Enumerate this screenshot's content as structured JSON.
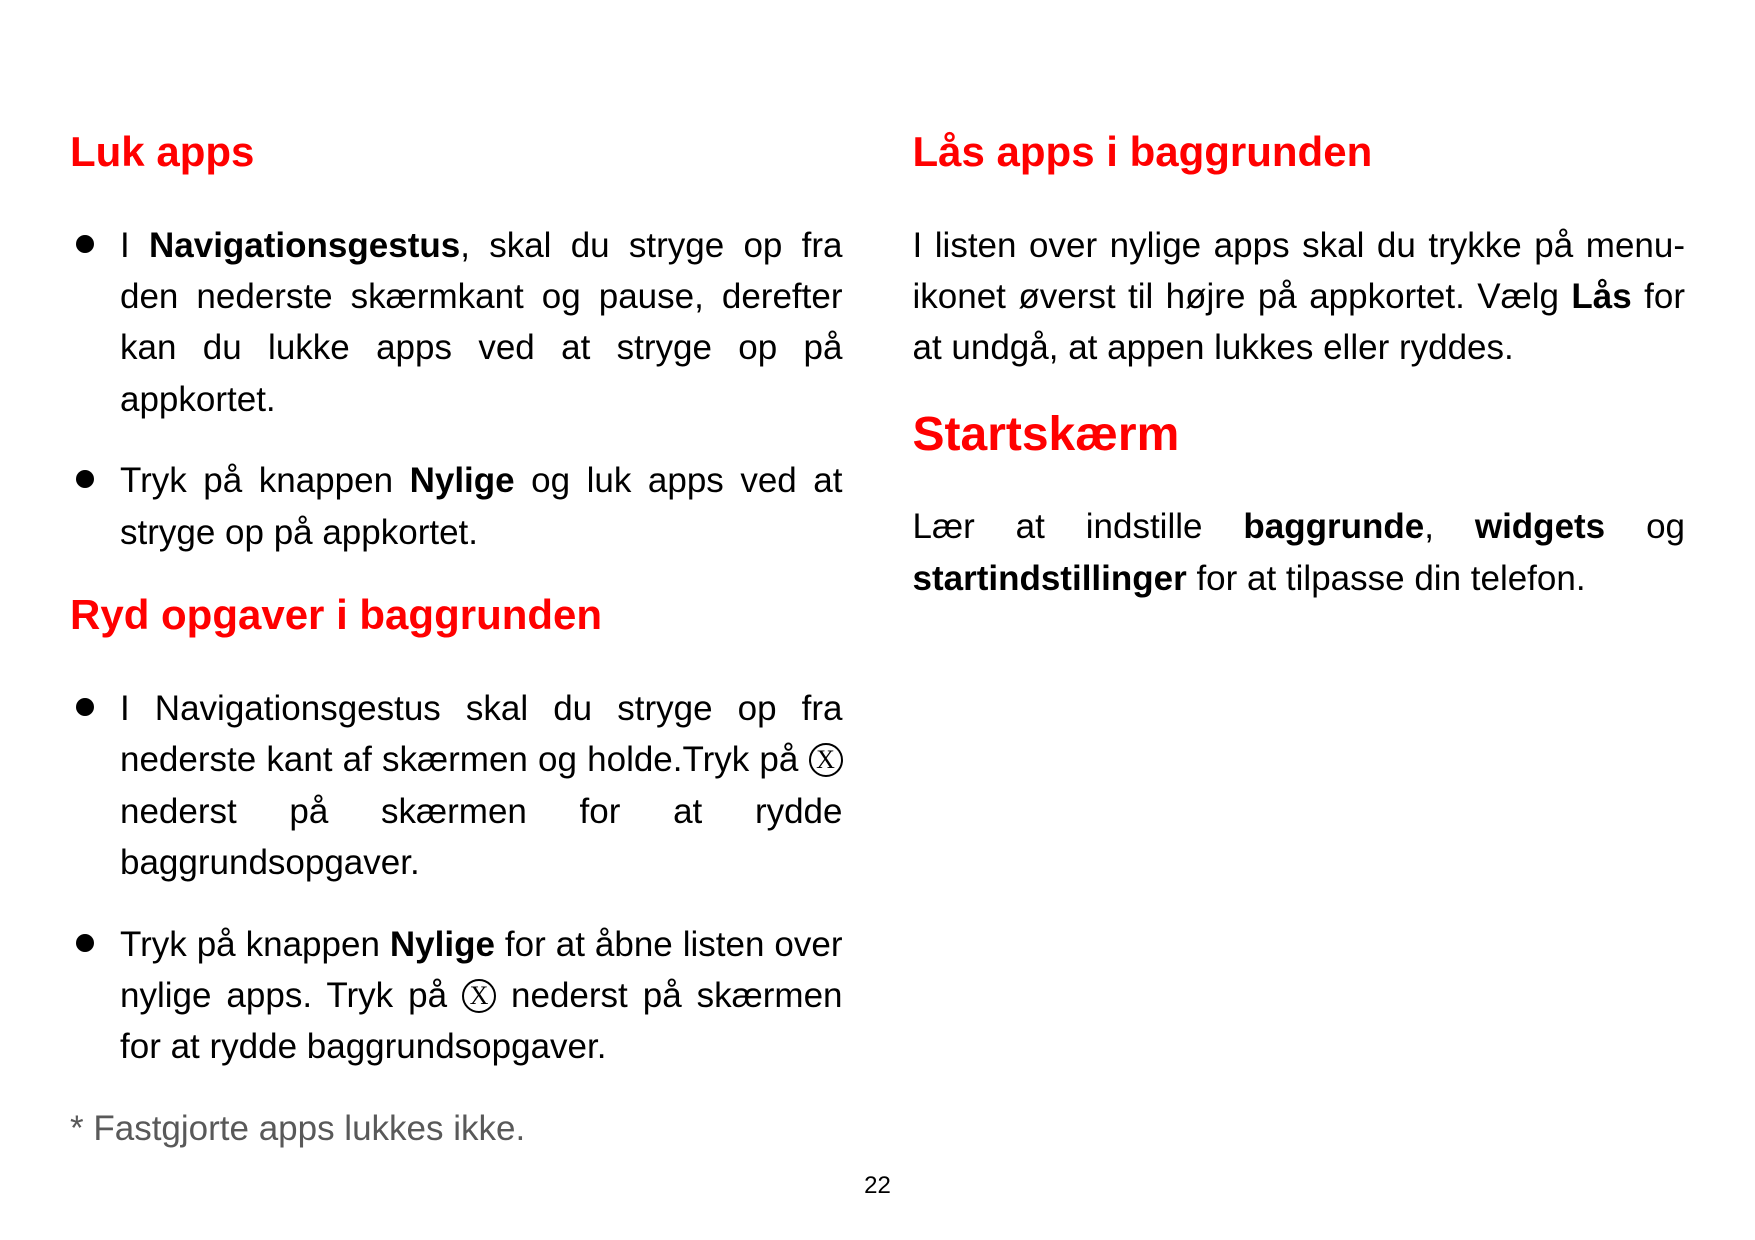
{
  "icons": {
    "circle_x_glyph": "X"
  },
  "page_number": "22",
  "left": {
    "h2a": "Luk apps",
    "li1_a": "I ",
    "li1_b_bold": "Navigationsgestus",
    "li1_c": ", skal du stryge op fra den nederste skærmkant og pause, derefter kan du lukke apps ved at stryge op på appkortet.",
    "li2_a": "Tryk på knappen ",
    "li2_b_bold": "Nylige",
    "li2_c": " og luk apps ved at stryge op på appkortet.",
    "h2b": "Ryd opgaver i baggrunden",
    "li3_a": "I Navigationsgestus skal du stryge op fra nederste kant af skærmen og holde.Tryk på ",
    "li3_b": " nederst på skærmen for at rydde baggrundsopgaver."
  },
  "right": {
    "li4_a": "Tryk på knappen ",
    "li4_b_bold": "Nylige",
    "li4_c": " for at åbne listen over nylige apps. Tryk på ",
    "li4_d": " nederst på skærmen for at rydde baggrundsopgaver.",
    "footnote": "* Fastgjorte apps lukkes ikke.",
    "h2c": "Lås apps i baggrunden",
    "p1_a": "I listen over nylige apps skal du trykke på menu-ikonet øverst til højre på appkortet. Vælg ",
    "p1_b_bold": "Lås",
    "p1_c": " for at undgå, at appen lukkes eller ryddes.",
    "h1": "Startskærm",
    "p2_a": "Lær at indstille ",
    "p2_b_bold": "baggrunde",
    "p2_c": ", ",
    "p2_d_bold": "widgets",
    "p2_e": " og ",
    "p2_f_bold": "startindstillinger",
    "p2_g": " for at tilpasse din telefon."
  }
}
